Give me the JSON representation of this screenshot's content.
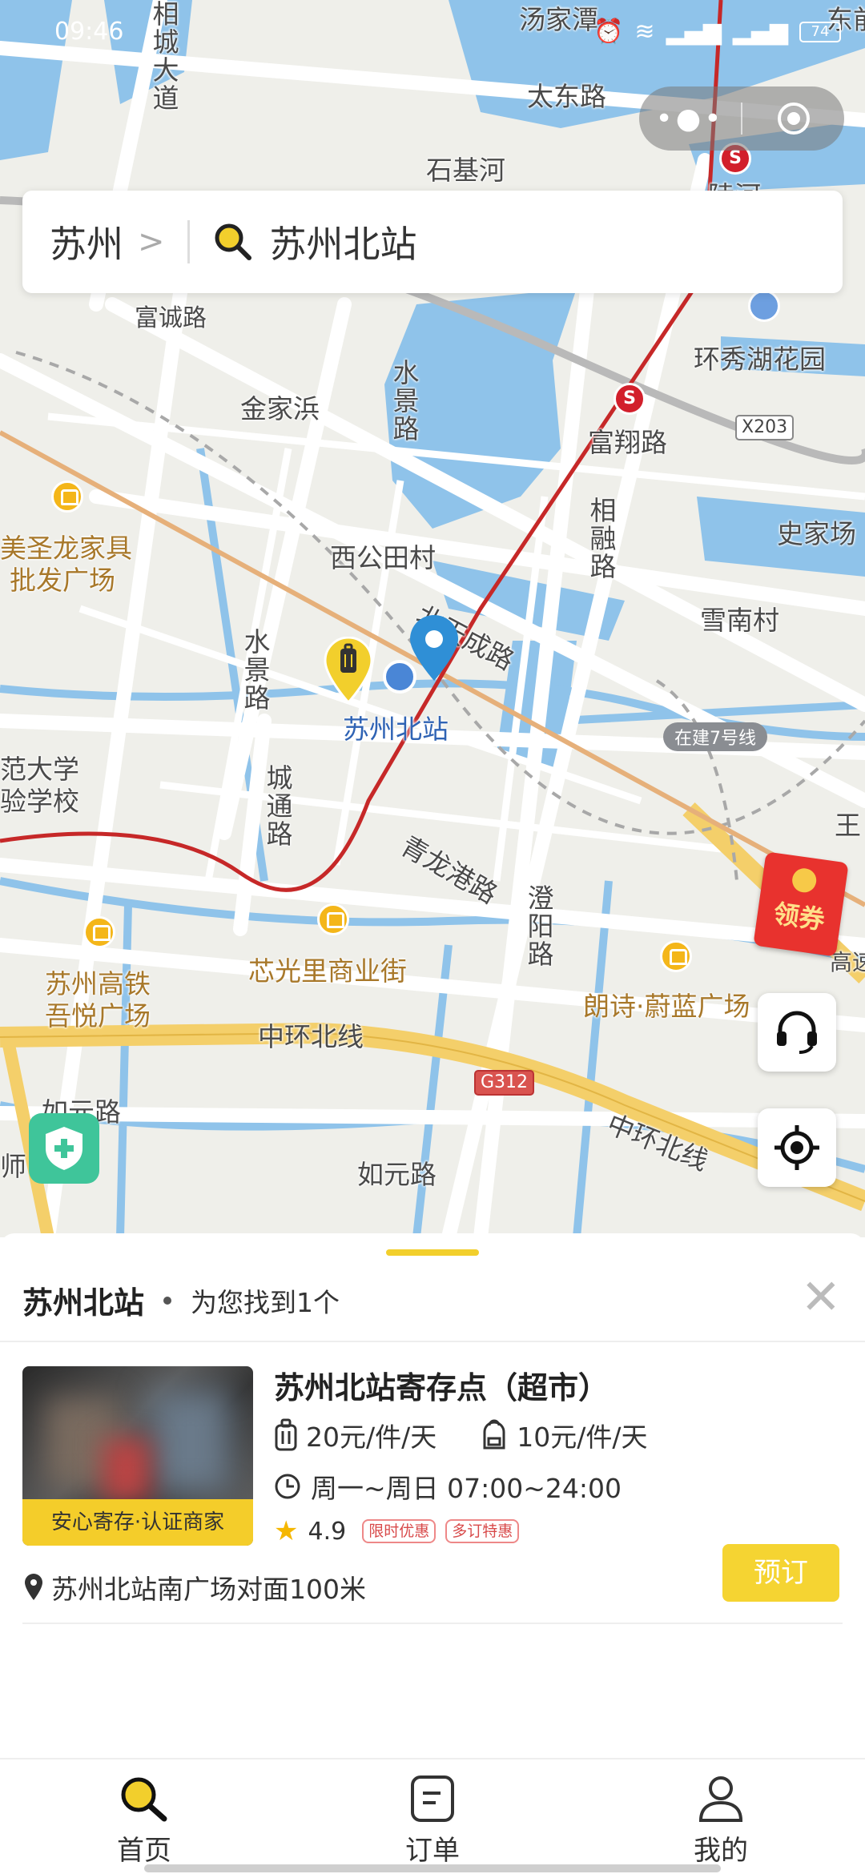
{
  "status_bar": {
    "time": "09:46",
    "battery": "74"
  },
  "search": {
    "city": "苏州",
    "query": "苏州北站"
  },
  "map": {
    "labels": {
      "tangjiatan": "汤家潭",
      "dongqian": "东前",
      "taidong_road": "太东路",
      "shiji_he": "石基河",
      "linghe": "陵河",
      "xiangcheng_avenue": "相城大道",
      "fucheng_road": "富诚路",
      "jinjiabang": "金家浜",
      "shuijing_road_1": "水景路",
      "huanxiu_garden": "环秀湖花园",
      "fuxiang_road": "富翔路",
      "x203": "X203",
      "shijiachang": "史家场",
      "meishenglong_1": "美圣龙家具",
      "meishenglong_2": "批发广场",
      "xiangrong_road": "相融路",
      "xigongtian": "西公田村",
      "beitiancheng_road": "北天成路",
      "xuenan": "雪南村",
      "shuijing_road_2": "水景路",
      "suzhou_north_station": "苏州北站",
      "line7": "在建7号线",
      "daxue_1": "范大学",
      "daxue_2": "验学校",
      "chengtong_road": "城通路",
      "wang": "王",
      "qinglonggang_road": "青龙港路",
      "chengyang_road": "澄阳路",
      "gaotie_plaza_1": "苏州高铁",
      "gaotie_plaza_2": "吾悦广场",
      "xinguangli": "芯光里商业街",
      "langshi": "朗诗·蔚蓝广场",
      "gaosu": "高速",
      "zhonghuan_north_1": "中环北线",
      "g312": "G312",
      "zhonghuan_north_2": "中环北线",
      "ruyuan_road_1": "如元路",
      "ruyuan_road_2": "如元路",
      "shi": "师"
    },
    "coupon_label": "领券"
  },
  "sheet": {
    "station": "苏州北站",
    "found_text": "为您找到1个",
    "result": {
      "title": "苏州北站寄存点（超市）",
      "badge": "安心寄存·认证商家",
      "price_large": "20元/件/天",
      "price_small": "10元/件/天",
      "hours": "周一~周日 07:00~24:00",
      "rating": "4.9",
      "tags": [
        "限时优惠",
        "多订特惠"
      ],
      "address": "苏州北站南广场对面100米",
      "book_label": "预订"
    }
  },
  "tabbar": {
    "home": "首页",
    "orders": "订单",
    "mine": "我的"
  },
  "colors": {
    "accent": "#f5d432",
    "metro_line": "#c62828",
    "water": "#8fc3ea"
  }
}
